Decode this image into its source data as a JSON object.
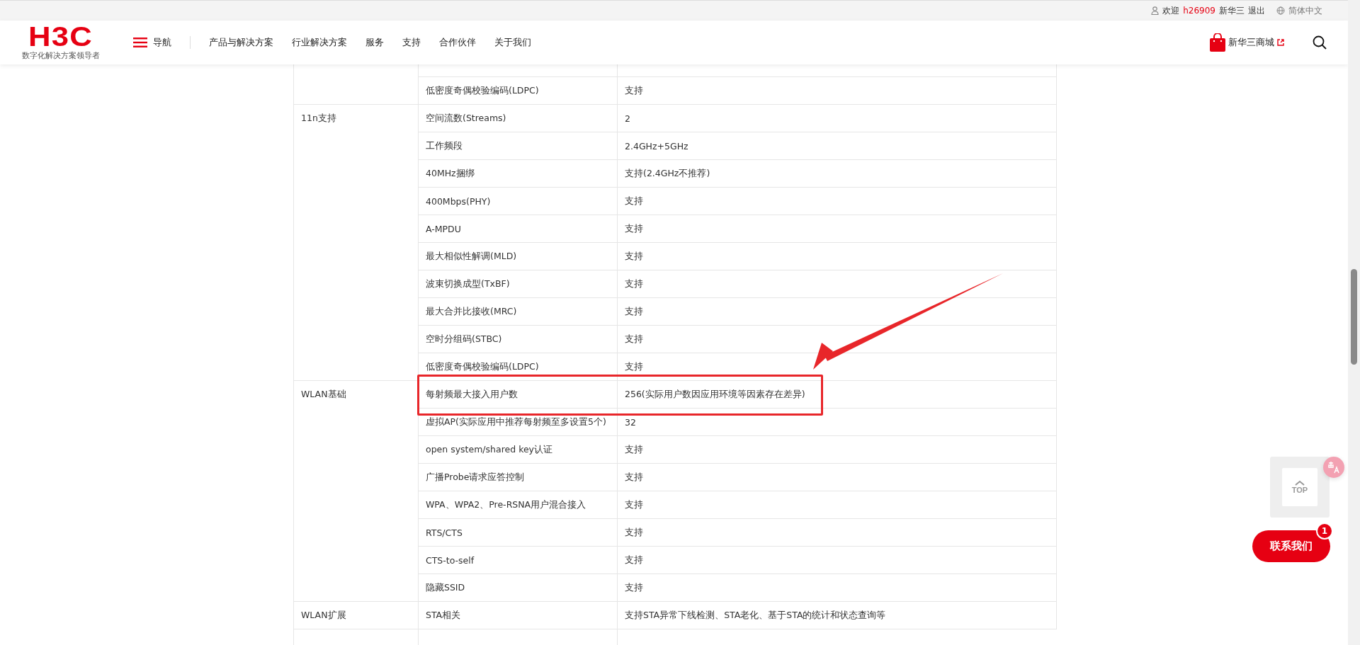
{
  "top_bar": {
    "greeting": "欢迎",
    "username": "h26909",
    "company": "新华三",
    "logout": "退出",
    "language": "简体中文"
  },
  "header": {
    "logo": "H3C",
    "slogan": "数字化解决方案领导者",
    "nav_toggle": "导航",
    "nav_items": [
      "产品与解决方案",
      "行业解决方案",
      "服务",
      "支持",
      "合作伙伴",
      "关于我们"
    ],
    "store": "新华三商城"
  },
  "spec_table": {
    "groups": [
      {
        "rows": [
          {
            "feature": "低密度奇偶校验编码(LDPC)",
            "value": "支持",
            "highlighted": false
          }
        ]
      },
      {
        "label": "11n支持",
        "rows": [
          {
            "feature": "空间流数(Streams)",
            "value": "2",
            "highlighted": false
          },
          {
            "feature": "工作频段",
            "value": "2.4GHz+5GHz",
            "highlighted": false
          },
          {
            "feature": "40MHz捆绑",
            "value": "支持(2.4GHz不推荐)",
            "highlighted": false
          },
          {
            "feature": "400Mbps(PHY)",
            "value": "支持",
            "highlighted": false
          },
          {
            "feature": "A-MPDU",
            "value": "支持",
            "highlighted": false
          },
          {
            "feature": "最大相似性解调(MLD)",
            "value": "支持",
            "highlighted": false
          },
          {
            "feature": "波束切换成型(TxBF)",
            "value": "支持",
            "highlighted": false
          },
          {
            "feature": "最大合并比接收(MRC)",
            "value": "支持",
            "highlighted": false
          },
          {
            "feature": "空时分组码(STBC)",
            "value": "支持",
            "highlighted": false
          },
          {
            "feature": "低密度奇偶校验编码(LDPC)",
            "value": "支持",
            "highlighted": false
          }
        ]
      },
      {
        "label": "WLAN基础",
        "rows": [
          {
            "feature": "每射频最大接入用户数",
            "value": "256(实际用户数因应用环境等因素存在差异)",
            "highlighted": true
          },
          {
            "feature": "虚拟AP(实际应用中推荐每射频至多设置5个)",
            "value": "32",
            "highlighted": false
          },
          {
            "feature": "open system/shared key认证",
            "value": "支持",
            "highlighted": false
          },
          {
            "feature": "广播Probe请求应答控制",
            "value": "支持",
            "highlighted": false
          },
          {
            "feature": "WPA、WPA2、Pre-RSNA用户混合接入",
            "value": "支持",
            "highlighted": false
          },
          {
            "feature": "RTS/CTS",
            "value": "支持",
            "highlighted": false
          },
          {
            "feature": "CTS-to-self",
            "value": "支持",
            "highlighted": false
          },
          {
            "feature": "隐藏SSID",
            "value": "支持",
            "highlighted": false
          }
        ]
      },
      {
        "label": "WLAN扩展",
        "rows": [
          {
            "feature": "STA相关",
            "value": "支持STA异常下线检测、STA老化、基于STA的统计和状态查询等",
            "highlighted": false
          }
        ]
      }
    ]
  },
  "side_tools": {
    "top_button": "TOP",
    "contact_button": "联系我们",
    "contact_badge": "1"
  }
}
